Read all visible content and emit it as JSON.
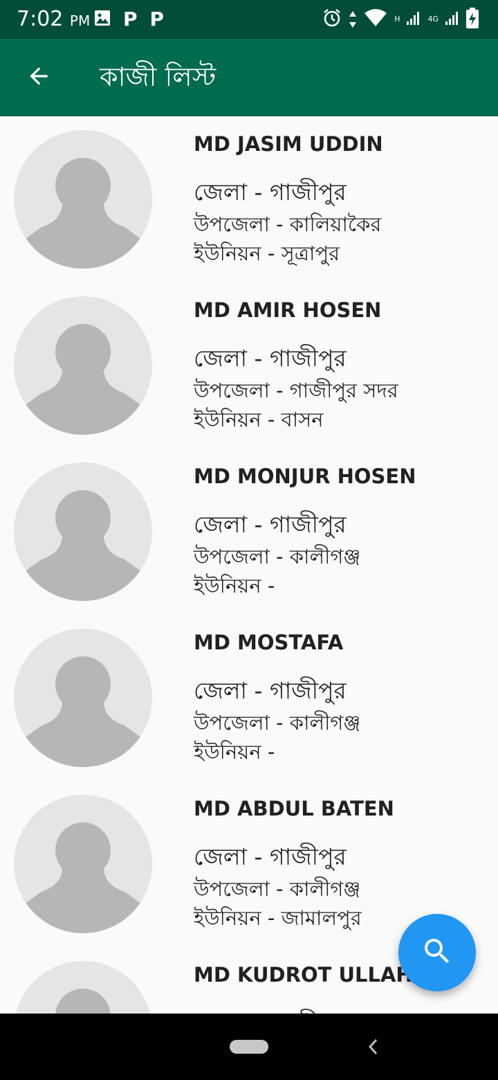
{
  "status_bar": {
    "time": "7:02",
    "ampm": "PM",
    "left_icons": [
      "image-icon",
      "p-icon",
      "p-icon"
    ],
    "p_glyph": "P",
    "net_h": "H",
    "net_4g": "4G",
    "right_icons": [
      "alarm-icon",
      "data-arrows-icon",
      "wifi-icon",
      "signal-icon",
      "signal-icon",
      "battery-charging-icon"
    ],
    "bg_color": "#014d3a"
  },
  "app_bar": {
    "title": "কাজী লিস্ট",
    "back_icon": "arrow-back-icon",
    "bg_color": "#006b4f"
  },
  "list": {
    "items": [
      {
        "name": "MD JASIM UDDIN",
        "district": "জেলা - গাজীপুর",
        "upazila": "উপজেলা - কালিয়াকৈর",
        "union": "ইউনিয়ন - সূত্রাপুর"
      },
      {
        "name": "MD AMIR HOSEN",
        "district": "জেলা - গাজীপুর",
        "upazila": "উপজেলা - গাজীপুর সদর",
        "union": "ইউনিয়ন - বাসন"
      },
      {
        "name": "MD MONJUR HOSEN",
        "district": "জেলা - গাজীপুর",
        "upazila": "উপজেলা - কালীগঞ্জ",
        "union": "ইউনিয়ন -"
      },
      {
        "name": "MD MOSTAFA",
        "district": "জেলা - গাজীপুর",
        "upazila": "উপজেলা - কালীগঞ্জ",
        "union": "ইউনিয়ন -"
      },
      {
        "name": "MD ABDUL BATEN",
        "district": "জেলা - গাজীপুর",
        "upazila": "উপজেলা - কালীগঞ্জ",
        "union": "ইউনিয়ন - জামালপুর"
      },
      {
        "name": "MD KUDROT ULLAH",
        "district": "জেলা - গাজীপুর",
        "upazila": "",
        "union": ""
      }
    ]
  },
  "fab": {
    "icon": "search-icon",
    "color": "#2196f3"
  },
  "nav_bar": {
    "icons": [
      "home-pill",
      "back-chevron-icon"
    ]
  }
}
